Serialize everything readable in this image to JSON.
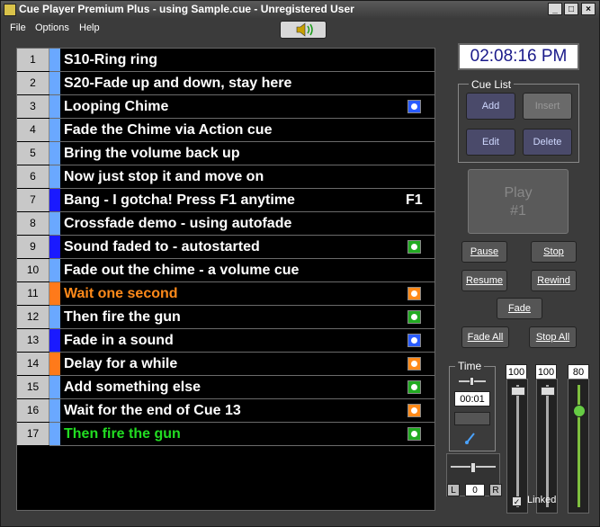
{
  "window": {
    "title": "Cue Player Premium Plus - using Sample.cue - Unregistered User"
  },
  "menu": [
    "File",
    "Options",
    "Help"
  ],
  "clock": "02:08:16 PM",
  "cue_list_group": {
    "label": "Cue List",
    "add": "Add",
    "insert": "Insert",
    "edit": "Edit",
    "delete": "Delete"
  },
  "play": {
    "line1": "Play",
    "line2": "#1"
  },
  "transport": {
    "pause": "Pause",
    "stop": "Stop",
    "resume": "Resume",
    "rewind": "Rewind",
    "fade": "Fade",
    "fade_all": "Fade All",
    "stop_all": "Stop All"
  },
  "time_panel": {
    "label": "Time",
    "value": "00:01"
  },
  "pan": {
    "left": "L",
    "value": "0",
    "right": "R"
  },
  "volumes": [
    "100",
    "100",
    "80"
  ],
  "linked_label": "Linked",
  "colors": {
    "blue_strip": "#1a1aff",
    "light_strip": "#4aa3ff",
    "orange": "#ff8a1a",
    "green": "#22cc22"
  },
  "cues": [
    {
      "num": "1",
      "label": "S10-Ring ring",
      "strip": "#6aa8ff",
      "color": "#ffffff",
      "icon": ""
    },
    {
      "num": "2",
      "label": "S20-Fade up and down, stay here",
      "strip": "#6aa8ff",
      "color": "#ffffff",
      "icon": ""
    },
    {
      "num": "3",
      "label": "Looping Chime",
      "strip": "#6aa8ff",
      "color": "#ffffff",
      "icon": "blue"
    },
    {
      "num": "4",
      "label": "Fade the Chime via Action cue",
      "strip": "#6aa8ff",
      "color": "#ffffff",
      "icon": ""
    },
    {
      "num": "5",
      "label": "Bring the volume back up",
      "strip": "#6aa8ff",
      "color": "#ffffff",
      "icon": ""
    },
    {
      "num": "6",
      "label": "Now just stop it and move on",
      "strip": "#6aa8ff",
      "color": "#ffffff",
      "icon": ""
    },
    {
      "num": "7",
      "label": "Bang - I gotcha! Press F1 anytime",
      "strip": "#1a1aff",
      "color": "#ffffff",
      "icon": "",
      "hotkey": "F1"
    },
    {
      "num": "8",
      "label": "Crossfade demo  - using autofade",
      "strip": "#6aa8ff",
      "color": "#ffffff",
      "icon": ""
    },
    {
      "num": "9",
      "label": "Sound faded to - autostarted",
      "strip": "#1a1aff",
      "color": "#ffffff",
      "icon": "green"
    },
    {
      "num": "10",
      "label": "Fade out the chime - a volume cue",
      "strip": "#6aa8ff",
      "color": "#ffffff",
      "icon": ""
    },
    {
      "num": "11",
      "label": "Wait one second",
      "strip": "#ff7a1a",
      "color": "#ff8a1a",
      "icon": "orange"
    },
    {
      "num": "12",
      "label": "Then fire the gun",
      "strip": "#6aa8ff",
      "color": "#ffffff",
      "icon": "green"
    },
    {
      "num": "13",
      "label": "Fade in a sound",
      "strip": "#1a1aff",
      "color": "#ffffff",
      "icon": "blue"
    },
    {
      "num": "14",
      "label": "Delay for a while",
      "strip": "#ff7a1a",
      "color": "#ffffff",
      "icon": "orange"
    },
    {
      "num": "15",
      "label": "Add something else",
      "strip": "#6aa8ff",
      "color": "#ffffff",
      "icon": "green"
    },
    {
      "num": "16",
      "label": "Wait for the end of Cue 13",
      "strip": "#6aa8ff",
      "color": "#ffffff",
      "icon": "orange"
    },
    {
      "num": "17",
      "label": "Then fire the gun",
      "strip": "#6aa8ff",
      "color": "#22dd22",
      "icon": "green"
    }
  ]
}
